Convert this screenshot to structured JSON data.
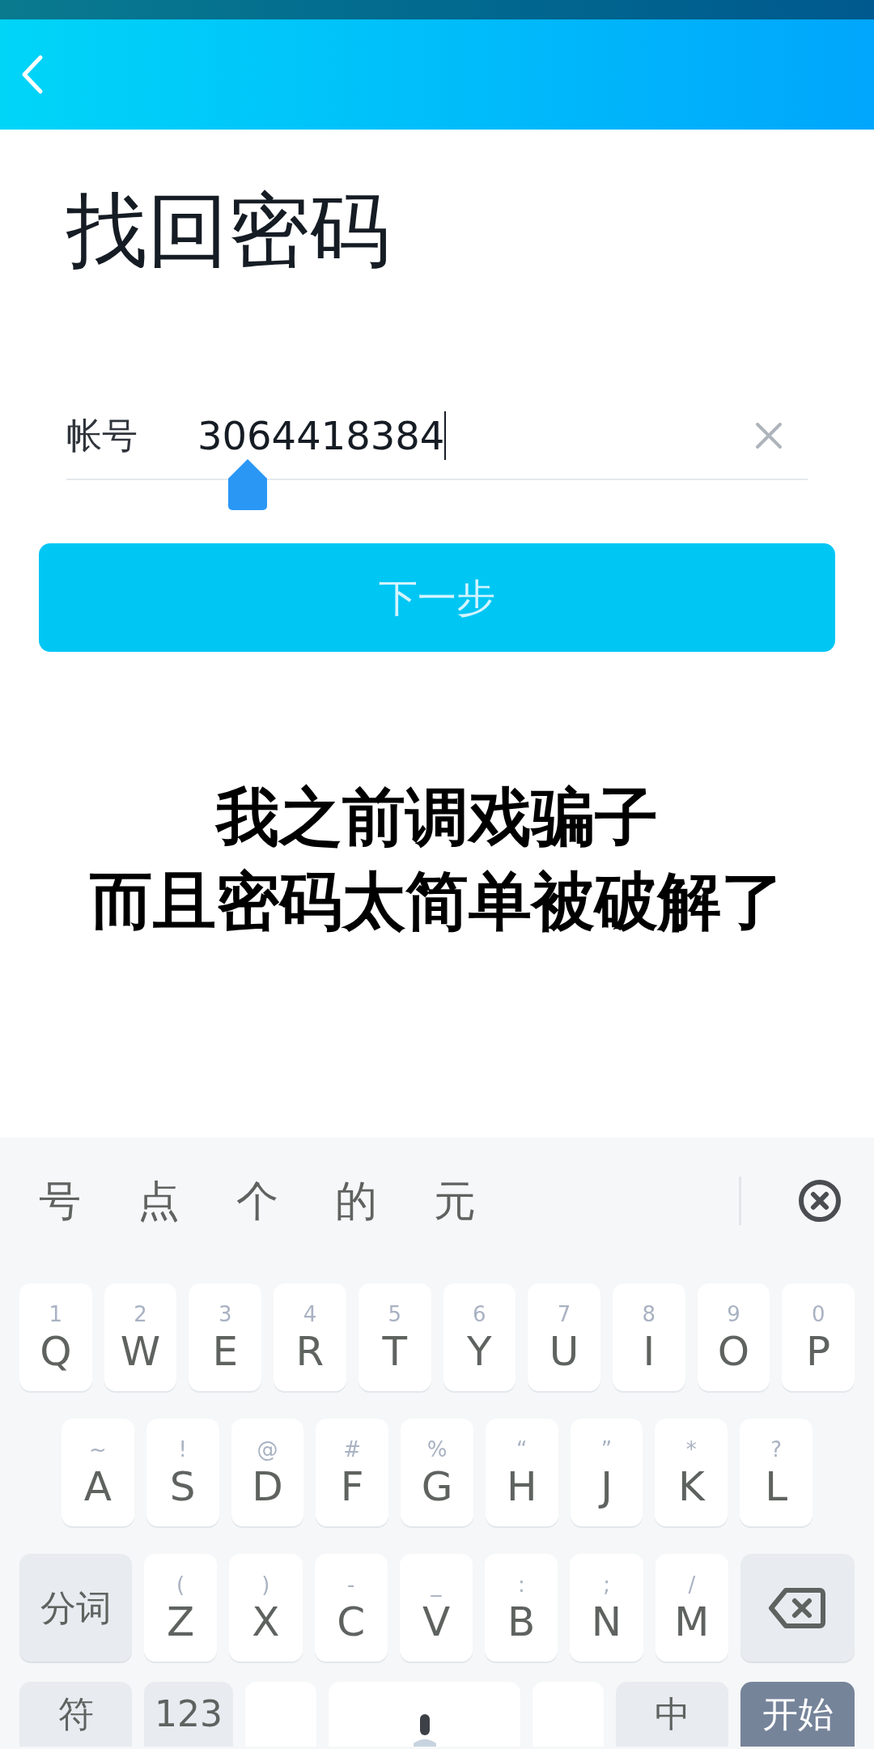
{
  "page_title": "找回密码",
  "account_field": {
    "label": "帐号",
    "value": "3064418384"
  },
  "next_button": {
    "label": "下一步"
  },
  "caption": [
    "我之前调戏骗子",
    "而且密码太简单被破解了"
  ],
  "keyboard": {
    "candidates": [
      "号",
      "点",
      "个",
      "的",
      "元"
    ],
    "top_row": [
      {
        "kind": "letter",
        "label": "Q",
        "hint": "1"
      },
      {
        "kind": "letter",
        "label": "W",
        "hint": "2"
      },
      {
        "kind": "letter",
        "label": "E",
        "hint": "3"
      },
      {
        "kind": "letter",
        "label": "R",
        "hint": "4"
      },
      {
        "kind": "letter",
        "label": "T",
        "hint": "5"
      },
      {
        "kind": "letter",
        "label": "Y",
        "hint": "6"
      },
      {
        "kind": "letter",
        "label": "U",
        "hint": "7"
      },
      {
        "kind": "letter",
        "label": "I",
        "hint": "8"
      },
      {
        "kind": "letter",
        "label": "O",
        "hint": "9"
      },
      {
        "kind": "letter",
        "label": "P",
        "hint": "0"
      }
    ],
    "home_row": [
      {
        "kind": "letter",
        "label": "A",
        "hint": "~"
      },
      {
        "kind": "letter",
        "label": "S",
        "hint": "!"
      },
      {
        "kind": "letter",
        "label": "D",
        "hint": "@"
      },
      {
        "kind": "letter",
        "label": "F",
        "hint": "#"
      },
      {
        "kind": "letter",
        "label": "G",
        "hint": "%"
      },
      {
        "kind": "letter",
        "label": "H",
        "hint": "“"
      },
      {
        "kind": "letter",
        "label": "J",
        "hint": "”"
      },
      {
        "kind": "letter",
        "label": "K",
        "hint": "*"
      },
      {
        "kind": "letter",
        "label": "L",
        "hint": "?"
      }
    ],
    "lower_row": [
      {
        "kind": "function",
        "label": "分词"
      },
      {
        "kind": "letter",
        "label": "Z",
        "hint": "("
      },
      {
        "kind": "letter",
        "label": "X",
        "hint": ")"
      },
      {
        "kind": "letter",
        "label": "C",
        "hint": "-"
      },
      {
        "kind": "letter",
        "label": "V",
        "hint": "_"
      },
      {
        "kind": "letter",
        "label": "B",
        "hint": ":"
      },
      {
        "kind": "letter",
        "label": "N",
        "hint": ";"
      },
      {
        "kind": "letter",
        "label": "M",
        "hint": "/"
      },
      {
        "kind": "backspace"
      }
    ],
    "function_row": [
      {
        "kind": "function",
        "label": "符"
      },
      {
        "kind": "function",
        "label": "123"
      },
      {
        "kind": "blank"
      },
      {
        "kind": "space"
      },
      {
        "kind": "blank"
      },
      {
        "kind": "function",
        "label": "中"
      },
      {
        "kind": "action",
        "label": "开始"
      }
    ]
  }
}
